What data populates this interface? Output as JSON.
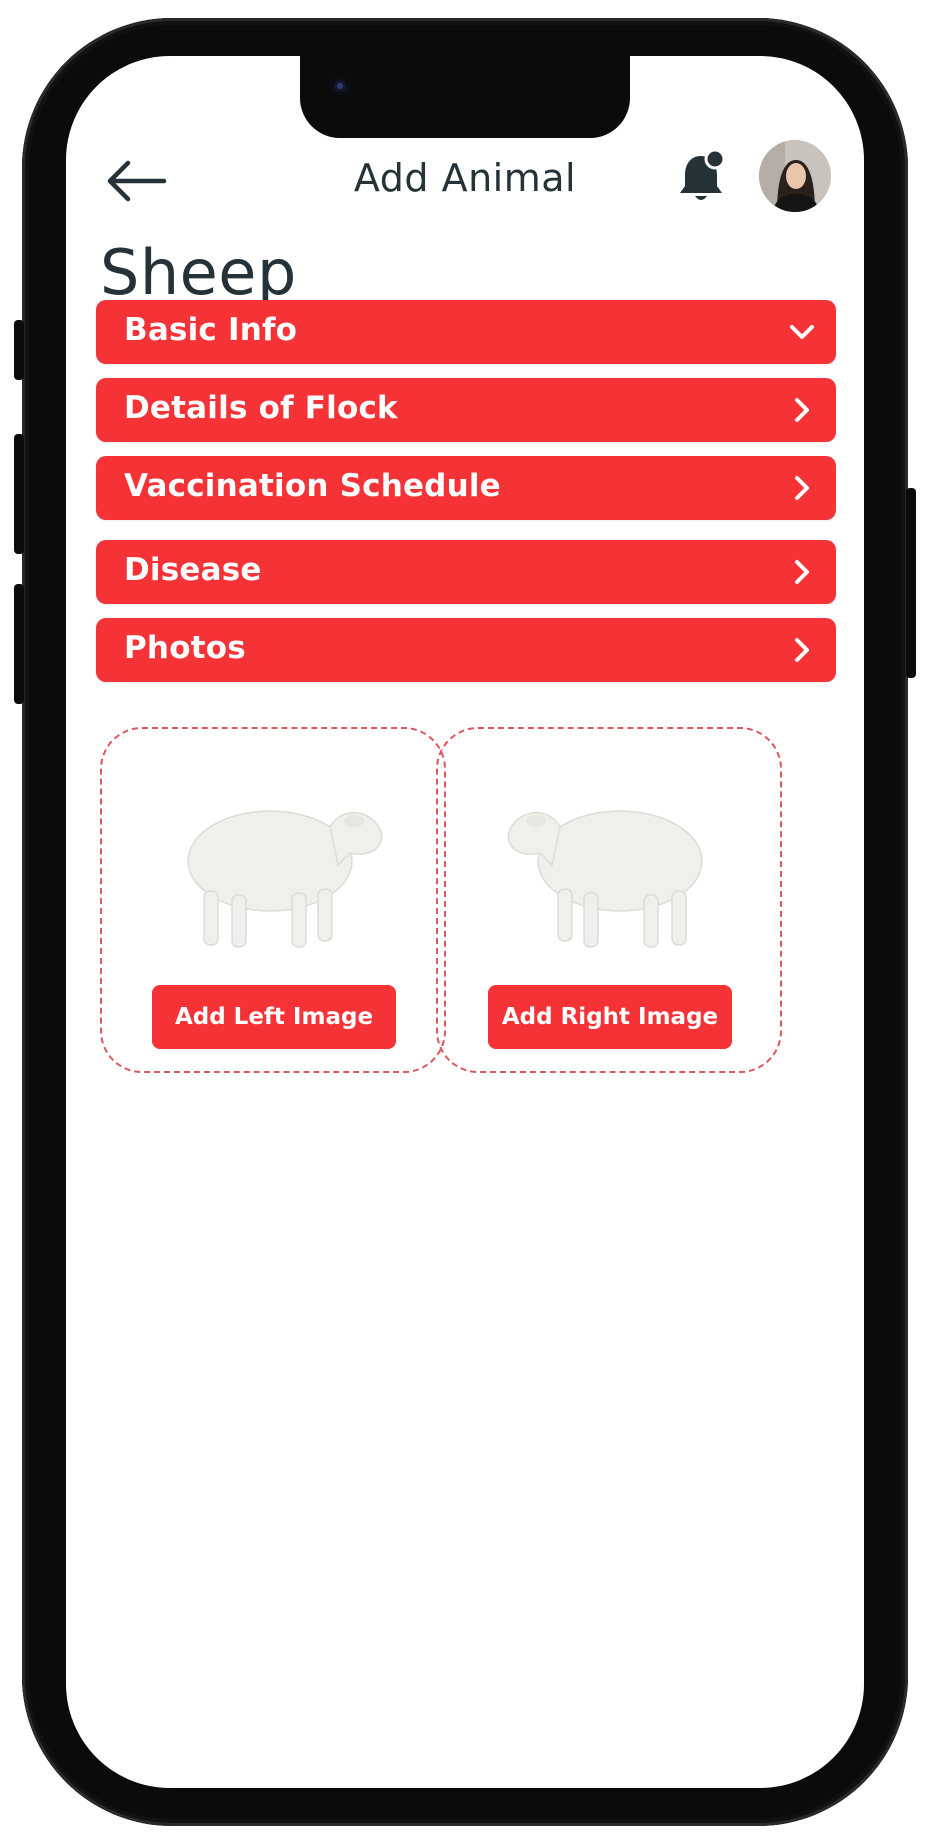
{
  "header": {
    "title": "Add Animal"
  },
  "page": {
    "title": "Sheep"
  },
  "sections": [
    {
      "label": "Basic Info",
      "state": "expanded"
    },
    {
      "label": "Details of Flock",
      "state": "collapsed"
    },
    {
      "label": "Vaccination Schedule",
      "state": "collapsed"
    },
    {
      "label": "Disease",
      "state": "collapsed"
    },
    {
      "label": "Photos",
      "state": "collapsed"
    }
  ],
  "photos": {
    "left_button": "Add Left Image",
    "right_button": "Add Right Image"
  },
  "colors": {
    "accent": "#f53236",
    "text_dark": "#253238",
    "dashed_border": "#d95a5e"
  },
  "icons": {
    "back": "arrow-left-icon",
    "notification": "bell-with-dot-icon",
    "expanded": "chevron-down-icon",
    "collapsed": "chevron-right-icon",
    "placeholder": "sheep-silhouette"
  }
}
